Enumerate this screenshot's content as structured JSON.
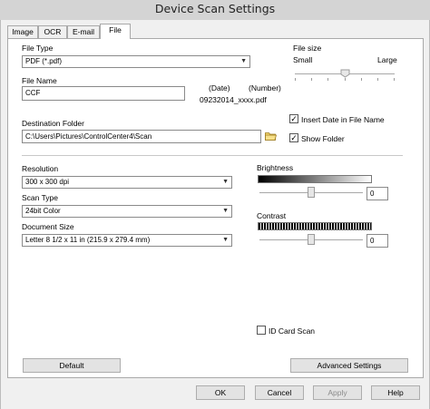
{
  "window": {
    "title": "Device Scan Settings"
  },
  "tabs": [
    {
      "label": "Image",
      "active": false
    },
    {
      "label": "OCR",
      "active": false
    },
    {
      "label": "E-mail",
      "active": false
    },
    {
      "label": "File",
      "active": true
    }
  ],
  "file_type": {
    "label": "File Type",
    "value": "PDF (*.pdf)"
  },
  "file_size": {
    "label": "File size",
    "small": "Small",
    "large": "Large",
    "level": 0.5
  },
  "file_name": {
    "label": "File Name",
    "value": "CCF",
    "date_label": "(Date)",
    "number_label": "(Number)",
    "example": "09232014_xxxx.pdf"
  },
  "destination": {
    "label": "Destination Folder",
    "value": "C:\\Users\\Pictures\\ControlCenter4\\Scan",
    "folder_icon": "folder-icon"
  },
  "checkboxes": {
    "insert_date": {
      "label": "Insert Date in File Name",
      "checked": true
    },
    "show_folder": {
      "label": "Show Folder",
      "checked": true
    },
    "id_card": {
      "label": "ID Card Scan",
      "checked": false
    }
  },
  "resolution": {
    "label": "Resolution",
    "value": "300 x 300 dpi"
  },
  "scan_type": {
    "label": "Scan Type",
    "value": "24bit Color"
  },
  "document_size": {
    "label": "Document Size",
    "value": "Letter 8 1/2 x 11 in (215.9 x 279.4 mm)"
  },
  "brightness": {
    "label": "Brightness",
    "value": "0",
    "level": 0.5
  },
  "contrast": {
    "label": "Contrast",
    "value": "0",
    "level": 0.5
  },
  "buttons": {
    "default": "Default",
    "advanced": "Advanced Settings",
    "ok": "OK",
    "cancel": "Cancel",
    "apply": "Apply",
    "help": "Help"
  },
  "colors": {
    "window_bg": "#f0f0f0",
    "panel_bg": "#ffffff",
    "border": "#a9a9a9"
  }
}
